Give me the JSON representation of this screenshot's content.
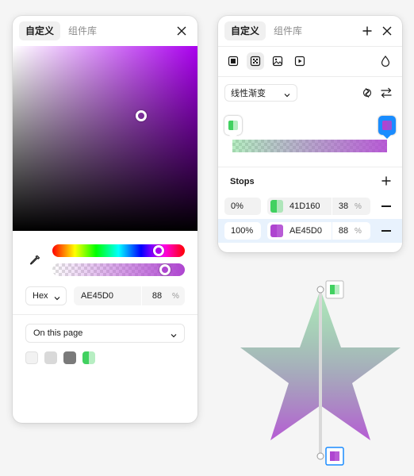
{
  "left_panel": {
    "tabs": [
      {
        "label": "自定义"
      },
      {
        "label": "组件库"
      }
    ],
    "format": "Hex",
    "hex": "AE45D0",
    "opacity": "88",
    "percent": "%",
    "library": "On this page",
    "swatches": [
      "#f2f2f2",
      "#d9d9d9",
      "#7a7a7a"
    ],
    "picked_hue_color": "#aa00ee",
    "hue_level_percent": 83,
    "alpha_level_percent": 88
  },
  "right_panel": {
    "tabs": [
      {
        "label": "自定义"
      },
      {
        "label": "组件库"
      }
    ],
    "paint_types": [
      "solid-fill-icon",
      "gradient-icon",
      "image-fill-icon",
      "video-fill-icon"
    ],
    "gradient_type": "线性渐变",
    "stops_title": "Stops",
    "stops": [
      {
        "position": "0%",
        "hex": "41D160",
        "opacity": "38",
        "percent": "%",
        "color": "#41d160"
      },
      {
        "position": "100%",
        "hex": "AE45D0",
        "opacity": "88",
        "percent": "%",
        "color": "#ae45d0"
      }
    ]
  },
  "canvas": {
    "shape": "star",
    "gradient_start": "#41d160",
    "gradient_start_opacity": 0.38,
    "gradient_end": "#ae45d0",
    "gradient_end_opacity": 0.88
  }
}
